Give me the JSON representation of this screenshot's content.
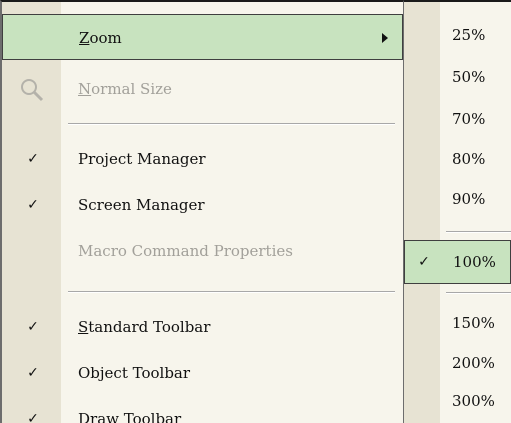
{
  "main_menu": {
    "items": [
      {
        "label": "Zoom",
        "underline": "Z"
      },
      {
        "label": "Normal Size",
        "underline": "N"
      },
      {
        "label": "Project Manager"
      },
      {
        "label": "Screen Manager"
      },
      {
        "label": "Macro Command Properties"
      },
      {
        "label": "Standard Toolbar",
        "underline": "S"
      },
      {
        "label": "Object Toolbar"
      },
      {
        "label": "Draw Toolbar"
      }
    ],
    "check_glyph": "✓"
  },
  "zoom_submenu": {
    "items": [
      "25%",
      "50%",
      "70%",
      "80%",
      "90%",
      "100%",
      "150%",
      "200%",
      "300%"
    ],
    "selected": "100%"
  },
  "colors": {
    "highlight": "#c8e3bf",
    "menu_bg": "#f7f5ec",
    "gutter": "#e7e3d3",
    "disabled_text": "#a2a09a"
  },
  "icons": [
    "magnifier-icon",
    "checkmark-icon",
    "submenu-arrow-icon"
  ]
}
